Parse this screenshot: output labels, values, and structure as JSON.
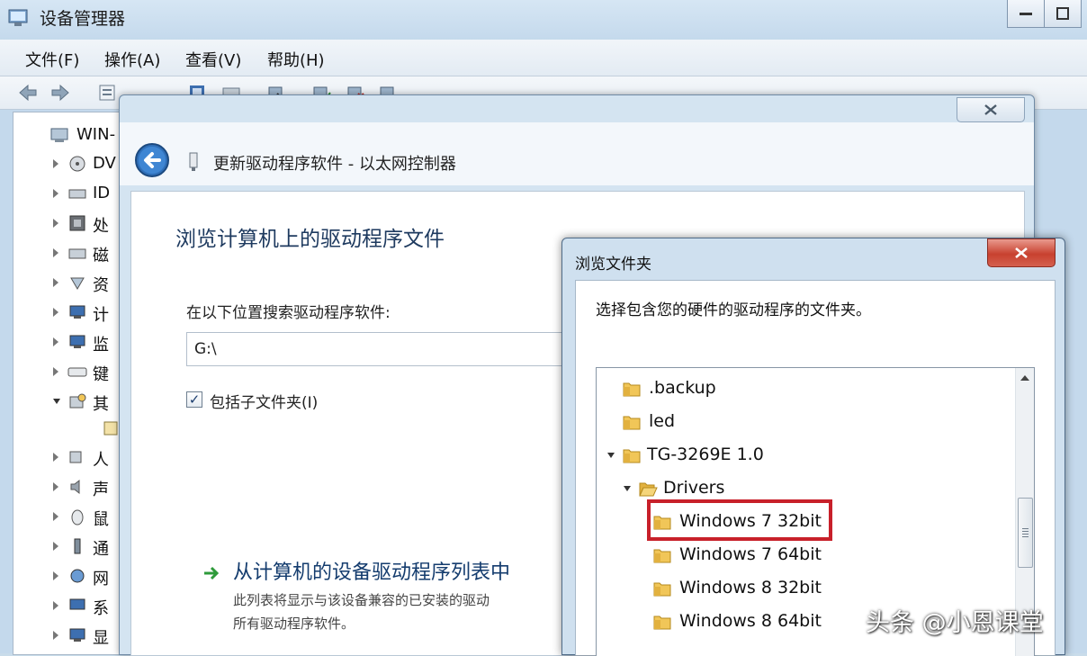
{
  "device_manager": {
    "title": "设备管理器",
    "menu": [
      "文件(F)",
      "操作(A)",
      "查看(V)",
      "帮助(H)"
    ],
    "tree_root": "WIN-",
    "tree_items": [
      "DV",
      "ID",
      "处",
      "磁",
      "资",
      "计",
      "监",
      "键",
      "其",
      "",
      "人",
      "声",
      "鼠",
      "通",
      "网",
      "系",
      "显"
    ]
  },
  "wizard": {
    "title": "更新驱动程序软件 - 以太网控制器",
    "heading": "浏览计算机上的驱动程序文件",
    "search_label": "在以下位置搜索驱动程序软件:",
    "path_value": "G:\\",
    "include_subfolders_checked": true,
    "include_subfolders_label": "包括子文件夹(I)",
    "pick_list_title": "从计算机的设备驱动程序列表中",
    "pick_list_desc_1": "此列表将显示与该设备兼容的已安装的驱动",
    "pick_list_desc_2": "所有驱动程序软件。"
  },
  "browse_dialog": {
    "title": "浏览文件夹",
    "close_glyph": "✕",
    "prompt": "选择包含您的硬件的驱动程序的文件夹。",
    "folders": [
      {
        "name": ".backup",
        "depth": 0,
        "expanded": false
      },
      {
        "name": "led",
        "depth": 0,
        "expanded": false
      },
      {
        "name": "TG-3269E 1.0",
        "depth": 0,
        "expanded": true
      },
      {
        "name": "Drivers",
        "depth": 1,
        "expanded": true
      },
      {
        "name": "Windows 7 32bit",
        "depth": 2,
        "expanded": false,
        "highlighted": true
      },
      {
        "name": "Windows 7 64bit",
        "depth": 2,
        "expanded": false
      },
      {
        "name": "Windows 8 32bit",
        "depth": 2,
        "expanded": false
      },
      {
        "name": "Windows 8 64bit",
        "depth": 2,
        "expanded": false
      }
    ]
  },
  "watermark": "头条 @小恩课堂",
  "colors": {
    "highlight_border": "#c8202a",
    "link_blue": "#143c6e",
    "close_red": "#c8412f",
    "folder_yellow": "#f1c658"
  }
}
